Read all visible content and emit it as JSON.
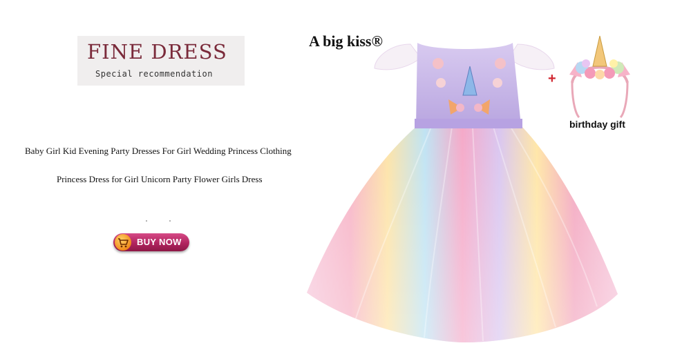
{
  "logo": {
    "title": "FINE DRESS",
    "subtitle": "Special recommendation"
  },
  "product": {
    "description_line1": "Baby Girl Kid Evening Party Dresses For Girl Wedding Princess Clothing",
    "description_line2": "Princess Dress for Girl Unicorn Party Flower Girls Dress"
  },
  "buy_button": {
    "label": "BUY NOW",
    "icon": "shopping-cart-icon"
  },
  "brand_label": "A big kiss®",
  "gift": {
    "plus": "+",
    "label": "birthday gift"
  },
  "colors": {
    "logo_text": "#7a2a3a",
    "buy_button": "#b0245f",
    "plus": "#d0262f",
    "dress_bodice": "#c9b8e8"
  }
}
